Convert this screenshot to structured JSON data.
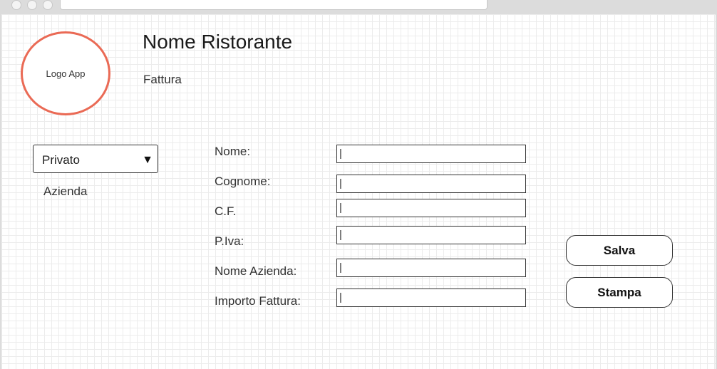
{
  "logo": {
    "label": "Logo App"
  },
  "header": {
    "restaurant_name": "Nome Ristorante",
    "subtitle": "Fattura"
  },
  "client_type": {
    "selected": "Privato",
    "caret": "▼",
    "options": [
      "Azienda"
    ]
  },
  "form": {
    "fields": [
      {
        "label": "Nome:",
        "value": "|"
      },
      {
        "label": "Cognome:",
        "value": "|"
      },
      {
        "label": "C.F.",
        "value": "|"
      },
      {
        "label": "P.Iva:",
        "value": "|"
      },
      {
        "label": "Nome Azienda:",
        "value": "|"
      },
      {
        "label": "Importo Fattura:",
        "value": "|"
      }
    ]
  },
  "actions": {
    "save_label": "Salva",
    "print_label": "Stampa"
  },
  "colors": {
    "logo_border": "#ea6a55",
    "grid": "#ececec",
    "chrome": "#dcdcdc"
  }
}
